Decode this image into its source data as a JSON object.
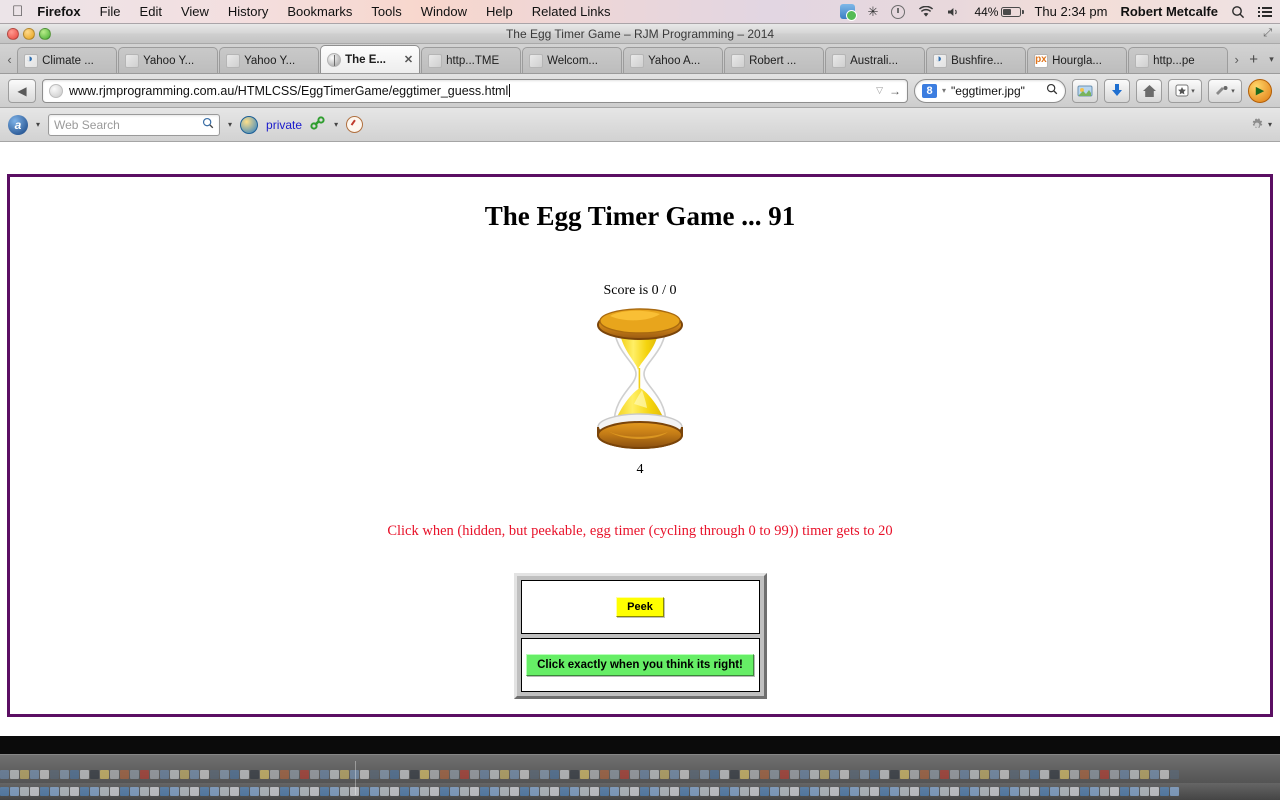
{
  "menubar": {
    "apple_icon": "apple-icon",
    "items": [
      {
        "label": "Firefox",
        "bold": true
      },
      {
        "label": "File",
        "bold": false
      },
      {
        "label": "Edit",
        "bold": false
      },
      {
        "label": "View",
        "bold": false
      },
      {
        "label": "History",
        "bold": false
      },
      {
        "label": "Bookmarks",
        "bold": false
      },
      {
        "label": "Tools",
        "bold": false
      },
      {
        "label": "Window",
        "bold": false
      },
      {
        "label": "Help",
        "bold": false
      },
      {
        "label": "Related Links",
        "bold": false
      }
    ],
    "status": {
      "dropbox_icon": "dropbox-icon",
      "bluetooth_icon": "bluetooth-icon",
      "bluetooth_glyph": "✳",
      "timemachine_icon": "time-machine-icon",
      "wifi_icon": "wifi-icon",
      "wifi_glyph": "◗",
      "volume_icon": "volume-icon",
      "volume_glyph": "◀",
      "battery_percent": "44%",
      "battery_icon": "battery-icon",
      "clock": "Thu 2:34 pm",
      "user": "Robert Metcalfe",
      "spotlight_icon": "search-icon",
      "spotlight_glyph": "⌕",
      "notifications_icon": "notification-center-icon",
      "notifications_glyph": "☰"
    }
  },
  "window": {
    "title": "The Egg Timer Game – RJM Programming – 2014",
    "expand_glyph": "⤢"
  },
  "tabs": {
    "scroll_left_glyph": "‹",
    "scroll_right_glyph": "›",
    "new_tab_glyph": "+",
    "list_all_glyph": "▾",
    "items": [
      {
        "label": "Climate ...",
        "favicon": "blue",
        "active": false
      },
      {
        "label": "Yahoo Y...",
        "favicon": "gray",
        "active": false
      },
      {
        "label": "Yahoo Y...",
        "favicon": "gray",
        "active": false
      },
      {
        "label": "The E...",
        "favicon": "globe",
        "active": true,
        "close_glyph": "✕"
      },
      {
        "label": "http...TME",
        "favicon": "gray",
        "active": false
      },
      {
        "label": "Welcom...",
        "favicon": "gray",
        "active": false
      },
      {
        "label": "Yahoo A...",
        "favicon": "gray",
        "active": false
      },
      {
        "label": "Robert ...",
        "favicon": "gray",
        "active": false
      },
      {
        "label": "Australi...",
        "favicon": "gray",
        "active": false
      },
      {
        "label": "Bushfire...",
        "favicon": "blue",
        "active": false
      },
      {
        "label": "Hourgla...",
        "favicon": "px",
        "active": false
      },
      {
        "label": "http...pe",
        "favicon": "gray",
        "active": false
      }
    ]
  },
  "navbar": {
    "back_glyph": "◀",
    "url": "www.rjmprogramming.com.au/HTMLCSS/EggTimerGame/eggtimer_guess.html",
    "url_dropdown_glyph": "▽",
    "url_go_glyph": "→",
    "search_engine": "8",
    "search_engine_name": "google-icon",
    "search_value": "\"eggtimer.jpg\"",
    "search_mag_glyph": "⌕",
    "buttons": [
      {
        "name": "sync-icon",
        "glyph": "◍"
      },
      {
        "name": "downloads-icon",
        "glyph": "⬇"
      },
      {
        "name": "home-icon",
        "glyph": "⌂"
      },
      {
        "name": "bookmarks-icon",
        "glyph": "★",
        "dropdown": true
      },
      {
        "name": "addons-icon",
        "glyph": "✎",
        "dropdown": true
      },
      {
        "name": "firefox-play-icon",
        "glyph": "▶"
      }
    ]
  },
  "navbar2": {
    "alexa_icon": "alexa-icon",
    "alexa_glyph": "a",
    "alexa_dropdown_glyph": "▾",
    "web_search_placeholder": "Web Search",
    "web_search_mag_glyph": "⌕",
    "web_search_dropdown_glyph": "▾",
    "world_icon": "globe-icon",
    "private_label": "private",
    "chain_icon": "link-icon",
    "chain_glyph": "🔗",
    "chain_dropdown_glyph": "▾",
    "clock_icon": "stopwatch-icon",
    "gear_icon": "gear-icon",
    "gear_glyph": "⚙",
    "gear_dropdown_glyph": "▾"
  },
  "page": {
    "title": "The Egg Timer Game ... 91",
    "score": "Score is 0 / 0",
    "hourglass_icon": "hourglass-icon",
    "counter": "4",
    "instruction": "Click when (hidden, but peekable, egg timer (cycling through 0 to 99)) timer gets to 20",
    "peek_button": "Peek",
    "guess_button": "Click exactly when you think its right!",
    "border_color": "#5b0f63",
    "instruction_color": "#e8122a",
    "peek_button_color": "#ffff00",
    "guess_button_color": "#66ee66"
  }
}
